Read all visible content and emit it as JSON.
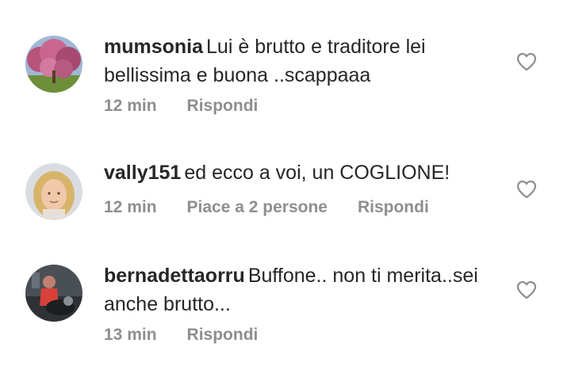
{
  "comments": [
    {
      "username": "mumsonia",
      "text": "Lui è  brutto e traditore lei bellissima e buona ..scappaaa",
      "time": "12 min",
      "likes": "",
      "reply": "Rispondi",
      "like_icon": "heart-outline-icon"
    },
    {
      "username": "vally151",
      "text": "ed ecco a voi, un COGLIONE!",
      "time": "12 min",
      "likes": "Piace a 2 persone",
      "reply": "Rispondi",
      "like_icon": "heart-outline-icon"
    },
    {
      "username": "bernadettaorru",
      "text": "Buffone.. non ti merita..sei anche brutto...",
      "time": "13 min",
      "likes": "",
      "reply": "Rispondi",
      "like_icon": "heart-outline-icon"
    }
  ]
}
